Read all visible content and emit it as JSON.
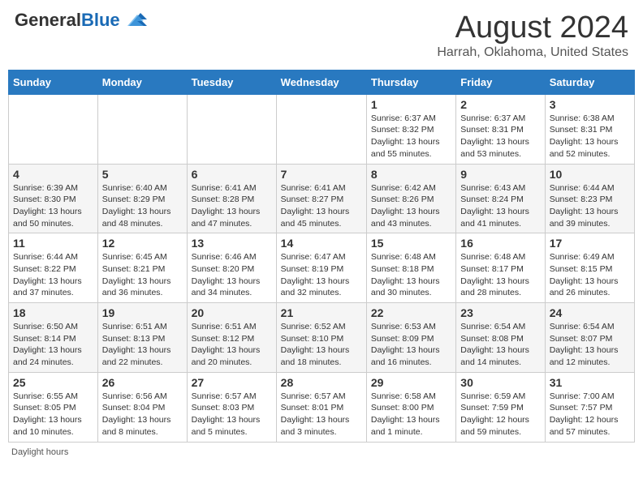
{
  "header": {
    "logo_general": "General",
    "logo_blue": "Blue",
    "month_title": "August 2024",
    "location": "Harrah, Oklahoma, United States"
  },
  "days_of_week": [
    "Sunday",
    "Monday",
    "Tuesday",
    "Wednesday",
    "Thursday",
    "Friday",
    "Saturday"
  ],
  "weeks": [
    [
      {
        "day": "",
        "info": ""
      },
      {
        "day": "",
        "info": ""
      },
      {
        "day": "",
        "info": ""
      },
      {
        "day": "",
        "info": ""
      },
      {
        "day": "1",
        "sunrise": "Sunrise: 6:37 AM",
        "sunset": "Sunset: 8:32 PM",
        "daylight": "Daylight: 13 hours and 55 minutes."
      },
      {
        "day": "2",
        "sunrise": "Sunrise: 6:37 AM",
        "sunset": "Sunset: 8:31 PM",
        "daylight": "Daylight: 13 hours and 53 minutes."
      },
      {
        "day": "3",
        "sunrise": "Sunrise: 6:38 AM",
        "sunset": "Sunset: 8:31 PM",
        "daylight": "Daylight: 13 hours and 52 minutes."
      }
    ],
    [
      {
        "day": "4",
        "sunrise": "Sunrise: 6:39 AM",
        "sunset": "Sunset: 8:30 PM",
        "daylight": "Daylight: 13 hours and 50 minutes."
      },
      {
        "day": "5",
        "sunrise": "Sunrise: 6:40 AM",
        "sunset": "Sunset: 8:29 PM",
        "daylight": "Daylight: 13 hours and 48 minutes."
      },
      {
        "day": "6",
        "sunrise": "Sunrise: 6:41 AM",
        "sunset": "Sunset: 8:28 PM",
        "daylight": "Daylight: 13 hours and 47 minutes."
      },
      {
        "day": "7",
        "sunrise": "Sunrise: 6:41 AM",
        "sunset": "Sunset: 8:27 PM",
        "daylight": "Daylight: 13 hours and 45 minutes."
      },
      {
        "day": "8",
        "sunrise": "Sunrise: 6:42 AM",
        "sunset": "Sunset: 8:26 PM",
        "daylight": "Daylight: 13 hours and 43 minutes."
      },
      {
        "day": "9",
        "sunrise": "Sunrise: 6:43 AM",
        "sunset": "Sunset: 8:24 PM",
        "daylight": "Daylight: 13 hours and 41 minutes."
      },
      {
        "day": "10",
        "sunrise": "Sunrise: 6:44 AM",
        "sunset": "Sunset: 8:23 PM",
        "daylight": "Daylight: 13 hours and 39 minutes."
      }
    ],
    [
      {
        "day": "11",
        "sunrise": "Sunrise: 6:44 AM",
        "sunset": "Sunset: 8:22 PM",
        "daylight": "Daylight: 13 hours and 37 minutes."
      },
      {
        "day": "12",
        "sunrise": "Sunrise: 6:45 AM",
        "sunset": "Sunset: 8:21 PM",
        "daylight": "Daylight: 13 hours and 36 minutes."
      },
      {
        "day": "13",
        "sunrise": "Sunrise: 6:46 AM",
        "sunset": "Sunset: 8:20 PM",
        "daylight": "Daylight: 13 hours and 34 minutes."
      },
      {
        "day": "14",
        "sunrise": "Sunrise: 6:47 AM",
        "sunset": "Sunset: 8:19 PM",
        "daylight": "Daylight: 13 hours and 32 minutes."
      },
      {
        "day": "15",
        "sunrise": "Sunrise: 6:48 AM",
        "sunset": "Sunset: 8:18 PM",
        "daylight": "Daylight: 13 hours and 30 minutes."
      },
      {
        "day": "16",
        "sunrise": "Sunrise: 6:48 AM",
        "sunset": "Sunset: 8:17 PM",
        "daylight": "Daylight: 13 hours and 28 minutes."
      },
      {
        "day": "17",
        "sunrise": "Sunrise: 6:49 AM",
        "sunset": "Sunset: 8:15 PM",
        "daylight": "Daylight: 13 hours and 26 minutes."
      }
    ],
    [
      {
        "day": "18",
        "sunrise": "Sunrise: 6:50 AM",
        "sunset": "Sunset: 8:14 PM",
        "daylight": "Daylight: 13 hours and 24 minutes."
      },
      {
        "day": "19",
        "sunrise": "Sunrise: 6:51 AM",
        "sunset": "Sunset: 8:13 PM",
        "daylight": "Daylight: 13 hours and 22 minutes."
      },
      {
        "day": "20",
        "sunrise": "Sunrise: 6:51 AM",
        "sunset": "Sunset: 8:12 PM",
        "daylight": "Daylight: 13 hours and 20 minutes."
      },
      {
        "day": "21",
        "sunrise": "Sunrise: 6:52 AM",
        "sunset": "Sunset: 8:10 PM",
        "daylight": "Daylight: 13 hours and 18 minutes."
      },
      {
        "day": "22",
        "sunrise": "Sunrise: 6:53 AM",
        "sunset": "Sunset: 8:09 PM",
        "daylight": "Daylight: 13 hours and 16 minutes."
      },
      {
        "day": "23",
        "sunrise": "Sunrise: 6:54 AM",
        "sunset": "Sunset: 8:08 PM",
        "daylight": "Daylight: 13 hours and 14 minutes."
      },
      {
        "day": "24",
        "sunrise": "Sunrise: 6:54 AM",
        "sunset": "Sunset: 8:07 PM",
        "daylight": "Daylight: 13 hours and 12 minutes."
      }
    ],
    [
      {
        "day": "25",
        "sunrise": "Sunrise: 6:55 AM",
        "sunset": "Sunset: 8:05 PM",
        "daylight": "Daylight: 13 hours and 10 minutes."
      },
      {
        "day": "26",
        "sunrise": "Sunrise: 6:56 AM",
        "sunset": "Sunset: 8:04 PM",
        "daylight": "Daylight: 13 hours and 8 minutes."
      },
      {
        "day": "27",
        "sunrise": "Sunrise: 6:57 AM",
        "sunset": "Sunset: 8:03 PM",
        "daylight": "Daylight: 13 hours and 5 minutes."
      },
      {
        "day": "28",
        "sunrise": "Sunrise: 6:57 AM",
        "sunset": "Sunset: 8:01 PM",
        "daylight": "Daylight: 13 hours and 3 minutes."
      },
      {
        "day": "29",
        "sunrise": "Sunrise: 6:58 AM",
        "sunset": "Sunset: 8:00 PM",
        "daylight": "Daylight: 13 hours and 1 minute."
      },
      {
        "day": "30",
        "sunrise": "Sunrise: 6:59 AM",
        "sunset": "Sunset: 7:59 PM",
        "daylight": "Daylight: 12 hours and 59 minutes."
      },
      {
        "day": "31",
        "sunrise": "Sunrise: 7:00 AM",
        "sunset": "Sunset: 7:57 PM",
        "daylight": "Daylight: 12 hours and 57 minutes."
      }
    ]
  ],
  "footer": {
    "daylight_label": "Daylight hours"
  }
}
